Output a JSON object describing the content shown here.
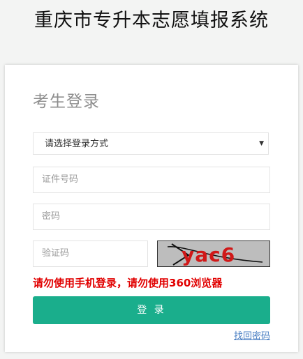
{
  "header": {
    "title": "重庆市专升本志愿填报系统"
  },
  "login": {
    "title": "考生登录",
    "login_method": {
      "selected": "请选择登录方式",
      "arrow_icon": "triangle-down-icon"
    },
    "id_field": {
      "placeholder": "证件号码"
    },
    "password_field": {
      "placeholder": "密码"
    },
    "captcha_field": {
      "placeholder": "验证码"
    },
    "captcha_image": {
      "text": "yac6"
    },
    "warning": "请勿使用手机登录，请勿使用360浏览器",
    "submit_label": "登 录",
    "forgot_link": "找回密码"
  },
  "colors": {
    "accent": "#1aae8c",
    "warning": "#e10000",
    "link": "#4a7fc3"
  }
}
